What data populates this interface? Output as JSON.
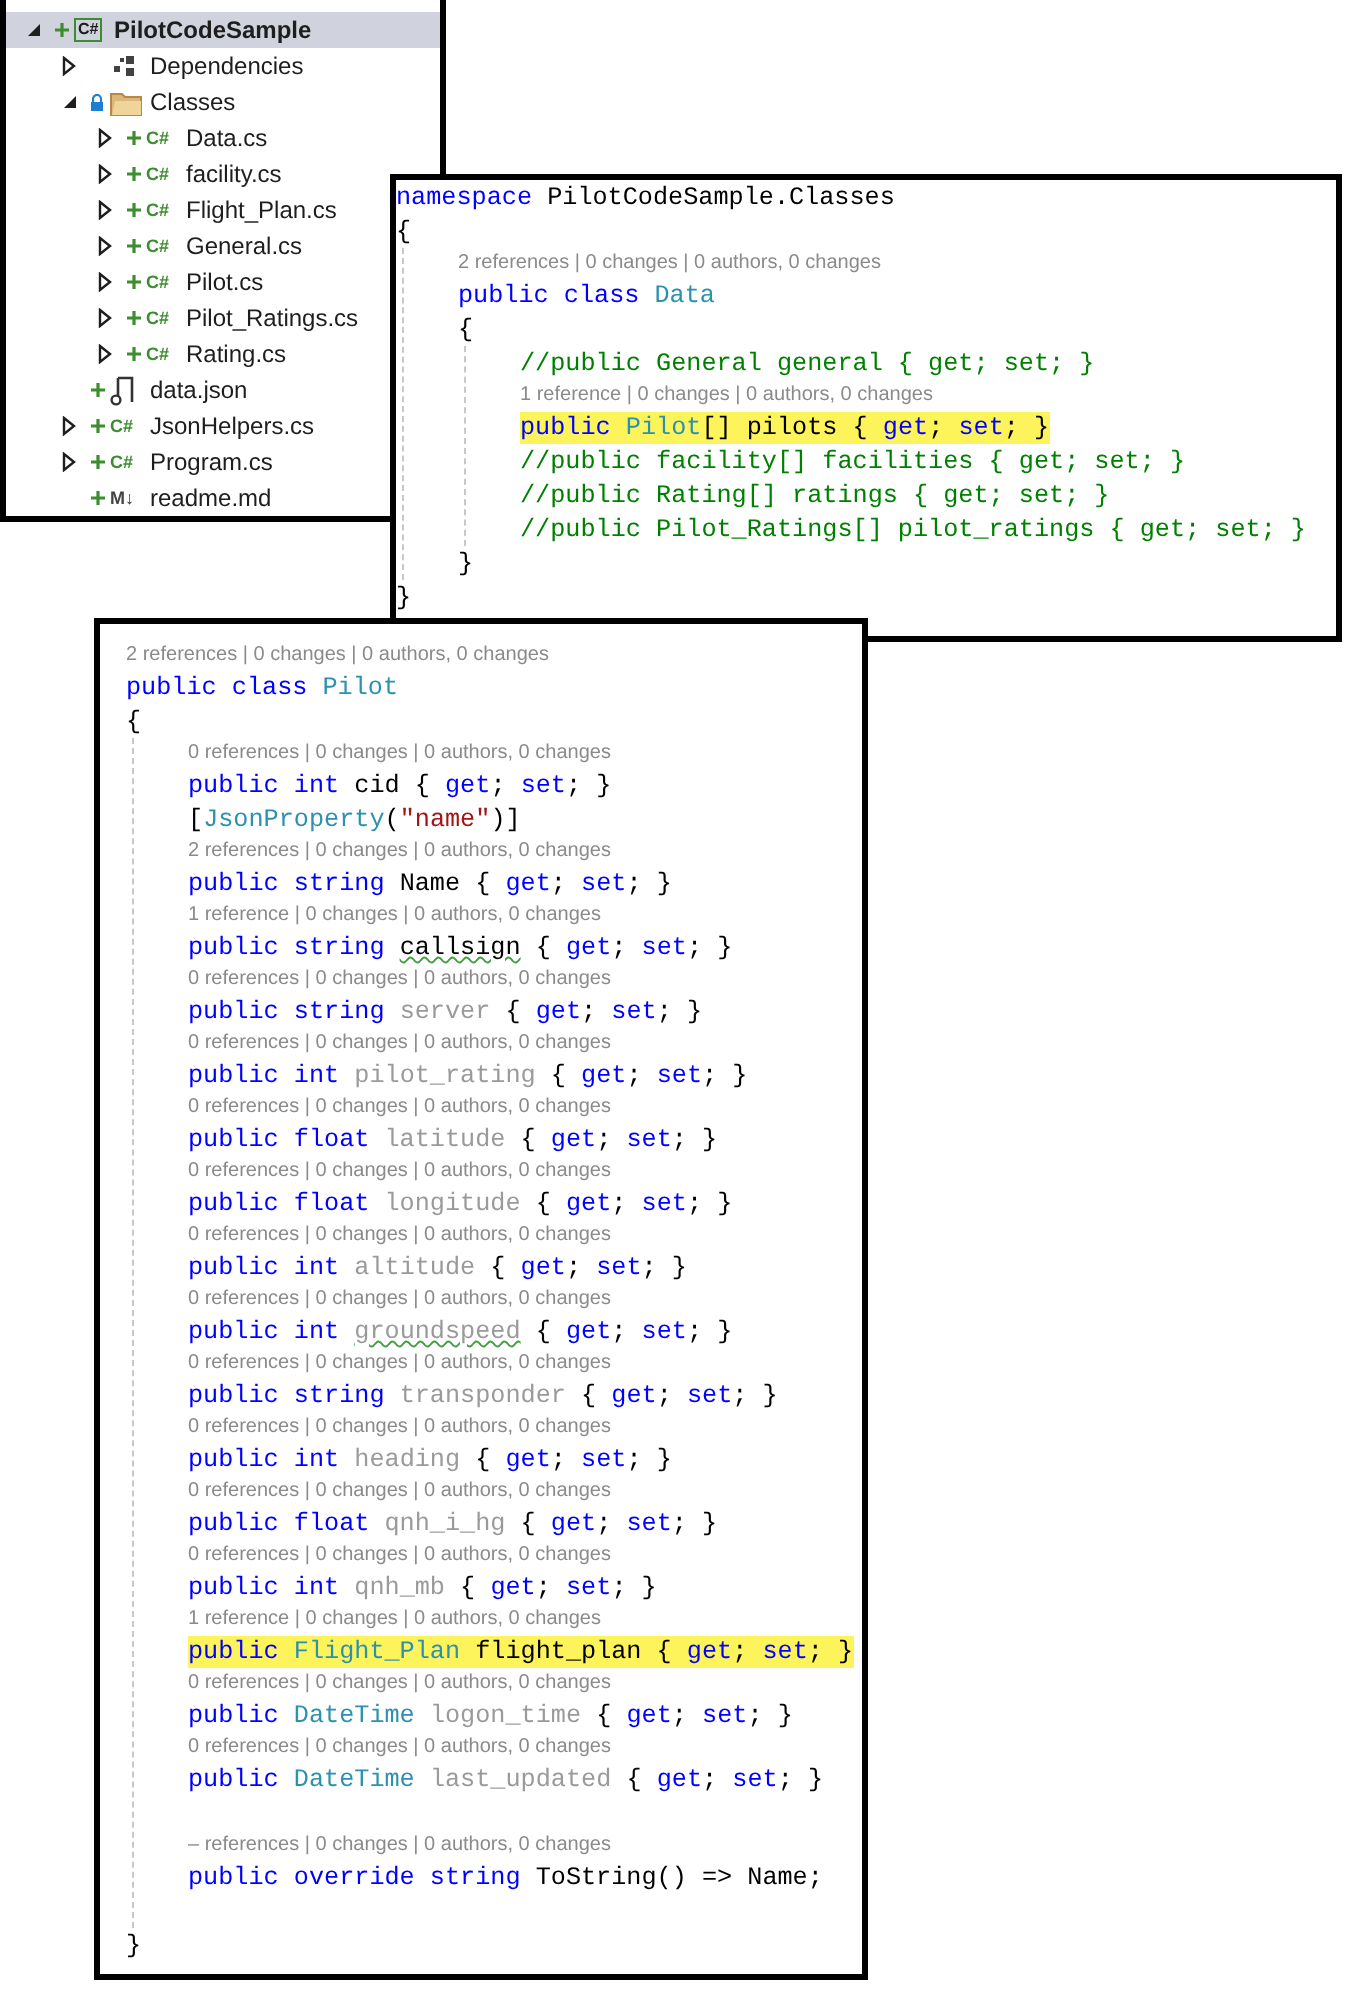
{
  "solution_explorer": {
    "items": [
      {
        "label": "PilotCodeSample",
        "kind": "project",
        "icon_label": "C#",
        "added": true,
        "locked": false,
        "selected": true,
        "expanded": true,
        "children": [
          {
            "label": "Dependencies",
            "kind": "dependencies",
            "added": false,
            "locked": false,
            "selected": false,
            "expanded": false
          },
          {
            "label": "Classes",
            "kind": "folder",
            "added": false,
            "locked": true,
            "selected": false,
            "expanded": true,
            "children": [
              {
                "label": "Data.cs",
                "kind": "csharp",
                "icon_label": "C#",
                "added": true,
                "locked": false,
                "selected": false,
                "expanded": false
              },
              {
                "label": "facility.cs",
                "kind": "csharp",
                "icon_label": "C#",
                "added": true,
                "locked": false,
                "selected": false,
                "expanded": false
              },
              {
                "label": "Flight_Plan.cs",
                "kind": "csharp",
                "icon_label": "C#",
                "added": true,
                "locked": false,
                "selected": false,
                "expanded": false
              },
              {
                "label": "General.cs",
                "kind": "csharp",
                "icon_label": "C#",
                "added": true,
                "locked": false,
                "selected": false,
                "expanded": false
              },
              {
                "label": "Pilot.cs",
                "kind": "csharp",
                "icon_label": "C#",
                "added": true,
                "locked": false,
                "selected": false,
                "expanded": false
              },
              {
                "label": "Pilot_Ratings.cs",
                "kind": "csharp",
                "icon_label": "C#",
                "added": true,
                "locked": false,
                "selected": false,
                "expanded": false
              },
              {
                "label": "Rating.cs",
                "kind": "csharp",
                "icon_label": "C#",
                "added": true,
                "locked": false,
                "selected": false,
                "expanded": false
              }
            ]
          },
          {
            "label": "data.json",
            "kind": "json",
            "added": true,
            "locked": false,
            "selected": false
          },
          {
            "label": "JsonHelpers.cs",
            "kind": "csharp",
            "icon_label": "C#",
            "added": true,
            "locked": false,
            "selected": false,
            "expanded": false
          },
          {
            "label": "Program.cs",
            "kind": "csharp",
            "icon_label": "C#",
            "added": true,
            "locked": false,
            "selected": false,
            "expanded": false
          },
          {
            "label": "readme.md",
            "kind": "markdown",
            "icon_label": "M↓",
            "added": true,
            "locked": false,
            "selected": false
          }
        ]
      }
    ]
  },
  "data_class_editor": {
    "lines": [
      {
        "kind": "code",
        "highlighted": false,
        "tokens": [
          {
            "kind": "keyword",
            "s": "namespace "
          },
          {
            "kind": "plain",
            "s": "PilotCodeSample.Classes"
          }
        ]
      },
      {
        "kind": "code",
        "highlighted": false,
        "tokens": [
          {
            "kind": "plain",
            "s": "{"
          }
        ]
      },
      {
        "kind": "block",
        "children": [
          {
            "kind": "lens",
            "text": "2 references | 0 changes | 0 authors, 0 changes"
          },
          {
            "kind": "code",
            "highlighted": false,
            "tokens": [
              {
                "kind": "keyword",
                "s": "public class "
              },
              {
                "kind": "type",
                "s": "Data"
              }
            ]
          },
          {
            "kind": "code",
            "highlighted": false,
            "tokens": [
              {
                "kind": "plain",
                "s": "{"
              }
            ]
          },
          {
            "kind": "block",
            "children": [
              {
                "kind": "code",
                "highlighted": false,
                "tokens": [
                  {
                    "kind": "comment",
                    "s": "//public General general { get; set; }"
                  }
                ]
              },
              {
                "kind": "lens",
                "text": "1 reference | 0 changes | 0 authors, 0 changes"
              },
              {
                "kind": "code",
                "highlighted": true,
                "tokens": [
                  {
                    "kind": "keyword",
                    "s": "public "
                  },
                  {
                    "kind": "type",
                    "s": "Pilot"
                  },
                  {
                    "kind": "plain",
                    "s": "[] pilots { "
                  },
                  {
                    "kind": "keyword",
                    "s": "get"
                  },
                  {
                    "kind": "plain",
                    "s": "; "
                  },
                  {
                    "kind": "keyword",
                    "s": "set"
                  },
                  {
                    "kind": "plain",
                    "s": "; }"
                  }
                ]
              },
              {
                "kind": "code",
                "highlighted": false,
                "tokens": [
                  {
                    "kind": "comment",
                    "s": "//public facility[] facilities { get; set; }"
                  }
                ]
              },
              {
                "kind": "code",
                "highlighted": false,
                "tokens": [
                  {
                    "kind": "comment",
                    "s": "//public Rating[] ratings { get; set; }"
                  }
                ]
              },
              {
                "kind": "code",
                "highlighted": false,
                "tokens": [
                  {
                    "kind": "comment",
                    "s": "//public Pilot_Ratings[] pilot_ratings { get; set; }"
                  }
                ]
              }
            ]
          },
          {
            "kind": "code",
            "highlighted": false,
            "tokens": [
              {
                "kind": "plain",
                "s": "}"
              }
            ]
          }
        ]
      },
      {
        "kind": "code",
        "highlighted": false,
        "tokens": [
          {
            "kind": "plain",
            "s": "}"
          }
        ]
      }
    ]
  },
  "pilot_class_editor": {
    "lines": [
      {
        "kind": "lens",
        "text": "2 references | 0 changes | 0 authors, 0 changes"
      },
      {
        "kind": "code",
        "highlighted": false,
        "tokens": [
          {
            "kind": "keyword",
            "s": "public class "
          },
          {
            "kind": "type",
            "s": "Pilot"
          }
        ]
      },
      {
        "kind": "code",
        "highlighted": false,
        "tokens": [
          {
            "kind": "plain",
            "s": "{"
          }
        ]
      },
      {
        "kind": "block",
        "children": [
          {
            "kind": "lens",
            "text": "0 references | 0 changes | 0 authors, 0 changes"
          },
          {
            "kind": "code",
            "highlighted": false,
            "tokens": [
              {
                "kind": "keyword",
                "s": "public int "
              },
              {
                "kind": "plain",
                "s": "cid { "
              },
              {
                "kind": "keyword",
                "s": "get"
              },
              {
                "kind": "plain",
                "s": "; "
              },
              {
                "kind": "keyword",
                "s": "set"
              },
              {
                "kind": "plain",
                "s": "; }"
              }
            ]
          },
          {
            "kind": "code",
            "highlighted": false,
            "tokens": [
              {
                "kind": "plain",
                "s": "["
              },
              {
                "kind": "type",
                "s": "JsonProperty"
              },
              {
                "kind": "plain",
                "s": "("
              },
              {
                "kind": "string",
                "s": "\"name\""
              },
              {
                "kind": "plain",
                "s": ")]"
              }
            ]
          },
          {
            "kind": "lens",
            "text": "2 references | 0 changes | 0 authors, 0 changes"
          },
          {
            "kind": "code",
            "highlighted": false,
            "tokens": [
              {
                "kind": "keyword",
                "s": "public string "
              },
              {
                "kind": "plain",
                "s": "Name { "
              },
              {
                "kind": "keyword",
                "s": "get"
              },
              {
                "kind": "plain",
                "s": "; "
              },
              {
                "kind": "keyword",
                "s": "set"
              },
              {
                "kind": "plain",
                "s": "; }"
              }
            ]
          },
          {
            "kind": "lens",
            "text": "1 reference | 0 changes | 0 authors, 0 changes"
          },
          {
            "kind": "code",
            "highlighted": false,
            "tokens": [
              {
                "kind": "keyword",
                "s": "public string "
              },
              {
                "kind": "plain",
                "s": "callsign",
                "squiggle": true
              },
              {
                "kind": "plain",
                "s": " { "
              },
              {
                "kind": "keyword",
                "s": "get"
              },
              {
                "kind": "plain",
                "s": "; "
              },
              {
                "kind": "keyword",
                "s": "set"
              },
              {
                "kind": "plain",
                "s": "; }"
              }
            ]
          },
          {
            "kind": "lens",
            "text": "0 references | 0 changes | 0 authors, 0 changes"
          },
          {
            "kind": "code",
            "highlighted": false,
            "tokens": [
              {
                "kind": "keyword",
                "s": "public string "
              },
              {
                "kind": "unused",
                "s": "server"
              },
              {
                "kind": "plain",
                "s": " { "
              },
              {
                "kind": "keyword",
                "s": "get"
              },
              {
                "kind": "plain",
                "s": "; "
              },
              {
                "kind": "keyword",
                "s": "set"
              },
              {
                "kind": "plain",
                "s": "; }"
              }
            ]
          },
          {
            "kind": "lens",
            "text": "0 references | 0 changes | 0 authors, 0 changes"
          },
          {
            "kind": "code",
            "highlighted": false,
            "tokens": [
              {
                "kind": "keyword",
                "s": "public int "
              },
              {
                "kind": "unused",
                "s": "pilot_rating"
              },
              {
                "kind": "plain",
                "s": " { "
              },
              {
                "kind": "keyword",
                "s": "get"
              },
              {
                "kind": "plain",
                "s": "; "
              },
              {
                "kind": "keyword",
                "s": "set"
              },
              {
                "kind": "plain",
                "s": "; }"
              }
            ]
          },
          {
            "kind": "lens",
            "text": "0 references | 0 changes | 0 authors, 0 changes"
          },
          {
            "kind": "code",
            "highlighted": false,
            "tokens": [
              {
                "kind": "keyword",
                "s": "public float "
              },
              {
                "kind": "unused",
                "s": "latitude"
              },
              {
                "kind": "plain",
                "s": " { "
              },
              {
                "kind": "keyword",
                "s": "get"
              },
              {
                "kind": "plain",
                "s": "; "
              },
              {
                "kind": "keyword",
                "s": "set"
              },
              {
                "kind": "plain",
                "s": "; }"
              }
            ]
          },
          {
            "kind": "lens",
            "text": "0 references | 0 changes | 0 authors, 0 changes"
          },
          {
            "kind": "code",
            "highlighted": false,
            "tokens": [
              {
                "kind": "keyword",
                "s": "public float "
              },
              {
                "kind": "unused",
                "s": "longitude"
              },
              {
                "kind": "plain",
                "s": " { "
              },
              {
                "kind": "keyword",
                "s": "get"
              },
              {
                "kind": "plain",
                "s": "; "
              },
              {
                "kind": "keyword",
                "s": "set"
              },
              {
                "kind": "plain",
                "s": "; }"
              }
            ]
          },
          {
            "kind": "lens",
            "text": "0 references | 0 changes | 0 authors, 0 changes"
          },
          {
            "kind": "code",
            "highlighted": false,
            "tokens": [
              {
                "kind": "keyword",
                "s": "public int "
              },
              {
                "kind": "unused",
                "s": "altitude"
              },
              {
                "kind": "plain",
                "s": " { "
              },
              {
                "kind": "keyword",
                "s": "get"
              },
              {
                "kind": "plain",
                "s": "; "
              },
              {
                "kind": "keyword",
                "s": "set"
              },
              {
                "kind": "plain",
                "s": "; }"
              }
            ]
          },
          {
            "kind": "lens",
            "text": "0 references | 0 changes | 0 authors, 0 changes"
          },
          {
            "kind": "code",
            "highlighted": false,
            "tokens": [
              {
                "kind": "keyword",
                "s": "public int "
              },
              {
                "kind": "unused",
                "s": "groundspeed",
                "squiggle": true
              },
              {
                "kind": "plain",
                "s": " { "
              },
              {
                "kind": "keyword",
                "s": "get"
              },
              {
                "kind": "plain",
                "s": "; "
              },
              {
                "kind": "keyword",
                "s": "set"
              },
              {
                "kind": "plain",
                "s": "; }"
              }
            ]
          },
          {
            "kind": "lens",
            "text": "0 references | 0 changes | 0 authors, 0 changes"
          },
          {
            "kind": "code",
            "highlighted": false,
            "tokens": [
              {
                "kind": "keyword",
                "s": "public string "
              },
              {
                "kind": "unused",
                "s": "transponder"
              },
              {
                "kind": "plain",
                "s": " { "
              },
              {
                "kind": "keyword",
                "s": "get"
              },
              {
                "kind": "plain",
                "s": "; "
              },
              {
                "kind": "keyword",
                "s": "set"
              },
              {
                "kind": "plain",
                "s": "; }"
              }
            ]
          },
          {
            "kind": "lens",
            "text": "0 references | 0 changes | 0 authors, 0 changes"
          },
          {
            "kind": "code",
            "highlighted": false,
            "tokens": [
              {
                "kind": "keyword",
                "s": "public int "
              },
              {
                "kind": "unused",
                "s": "heading"
              },
              {
                "kind": "plain",
                "s": " { "
              },
              {
                "kind": "keyword",
                "s": "get"
              },
              {
                "kind": "plain",
                "s": "; "
              },
              {
                "kind": "keyword",
                "s": "set"
              },
              {
                "kind": "plain",
                "s": "; }"
              }
            ]
          },
          {
            "kind": "lens",
            "text": "0 references | 0 changes | 0 authors, 0 changes"
          },
          {
            "kind": "code",
            "highlighted": false,
            "tokens": [
              {
                "kind": "keyword",
                "s": "public float "
              },
              {
                "kind": "unused",
                "s": "qnh_i_hg"
              },
              {
                "kind": "plain",
                "s": " { "
              },
              {
                "kind": "keyword",
                "s": "get"
              },
              {
                "kind": "plain",
                "s": "; "
              },
              {
                "kind": "keyword",
                "s": "set"
              },
              {
                "kind": "plain",
                "s": "; }"
              }
            ]
          },
          {
            "kind": "lens",
            "text": "0 references | 0 changes | 0 authors, 0 changes"
          },
          {
            "kind": "code",
            "highlighted": false,
            "tokens": [
              {
                "kind": "keyword",
                "s": "public int "
              },
              {
                "kind": "unused",
                "s": "qnh_mb"
              },
              {
                "kind": "plain",
                "s": " { "
              },
              {
                "kind": "keyword",
                "s": "get"
              },
              {
                "kind": "plain",
                "s": "; "
              },
              {
                "kind": "keyword",
                "s": "set"
              },
              {
                "kind": "plain",
                "s": "; }"
              }
            ]
          },
          {
            "kind": "lens",
            "text": "1 reference | 0 changes | 0 authors, 0 changes"
          },
          {
            "kind": "code",
            "highlighted": true,
            "tokens": [
              {
                "kind": "keyword",
                "s": "public "
              },
              {
                "kind": "type",
                "s": "Flight_Plan"
              },
              {
                "kind": "plain",
                "s": " flight_plan { "
              },
              {
                "kind": "keyword",
                "s": "get"
              },
              {
                "kind": "plain",
                "s": "; "
              },
              {
                "kind": "keyword",
                "s": "set"
              },
              {
                "kind": "plain",
                "s": "; }"
              }
            ]
          },
          {
            "kind": "lens",
            "text": "0 references | 0 changes | 0 authors, 0 changes"
          },
          {
            "kind": "code",
            "highlighted": false,
            "tokens": [
              {
                "kind": "keyword",
                "s": "public "
              },
              {
                "kind": "type",
                "s": "DateTime "
              },
              {
                "kind": "unused",
                "s": "logon_time"
              },
              {
                "kind": "plain",
                "s": " { "
              },
              {
                "kind": "keyword",
                "s": "get"
              },
              {
                "kind": "plain",
                "s": "; "
              },
              {
                "kind": "keyword",
                "s": "set"
              },
              {
                "kind": "plain",
                "s": "; }"
              }
            ]
          },
          {
            "kind": "lens",
            "text": "0 references | 0 changes | 0 authors, 0 changes"
          },
          {
            "kind": "code",
            "highlighted": false,
            "tokens": [
              {
                "kind": "keyword",
                "s": "public "
              },
              {
                "kind": "type",
                "s": "DateTime "
              },
              {
                "kind": "unused",
                "s": "last_updated"
              },
              {
                "kind": "plain",
                "s": " { "
              },
              {
                "kind": "keyword",
                "s": "get"
              },
              {
                "kind": "plain",
                "s": "; "
              },
              {
                "kind": "keyword",
                "s": "set"
              },
              {
                "kind": "plain",
                "s": "; }"
              }
            ]
          },
          {
            "kind": "blank"
          },
          {
            "kind": "lens",
            "text": "– references | 0 changes | 0 authors, 0 changes"
          },
          {
            "kind": "code",
            "highlighted": false,
            "tokens": [
              {
                "kind": "keyword",
                "s": "public override string "
              },
              {
                "kind": "plain",
                "s": "ToString() => Name;"
              }
            ]
          },
          {
            "kind": "blank"
          }
        ]
      },
      {
        "kind": "code",
        "highlighted": false,
        "tokens": [
          {
            "kind": "plain",
            "s": "}"
          }
        ]
      }
    ]
  }
}
